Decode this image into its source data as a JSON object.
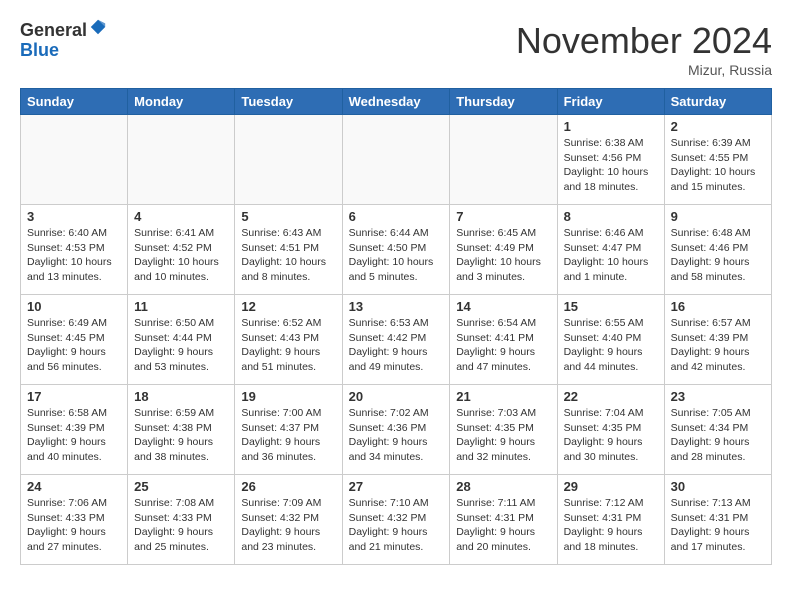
{
  "header": {
    "logo_line1": "General",
    "logo_line2": "Blue",
    "month_title": "November 2024",
    "location": "Mizur, Russia"
  },
  "weekdays": [
    "Sunday",
    "Monday",
    "Tuesday",
    "Wednesday",
    "Thursday",
    "Friday",
    "Saturday"
  ],
  "weeks": [
    [
      {
        "day": "",
        "info": ""
      },
      {
        "day": "",
        "info": ""
      },
      {
        "day": "",
        "info": ""
      },
      {
        "day": "",
        "info": ""
      },
      {
        "day": "",
        "info": ""
      },
      {
        "day": "1",
        "info": "Sunrise: 6:38 AM\nSunset: 4:56 PM\nDaylight: 10 hours\nand 18 minutes."
      },
      {
        "day": "2",
        "info": "Sunrise: 6:39 AM\nSunset: 4:55 PM\nDaylight: 10 hours\nand 15 minutes."
      }
    ],
    [
      {
        "day": "3",
        "info": "Sunrise: 6:40 AM\nSunset: 4:53 PM\nDaylight: 10 hours\nand 13 minutes."
      },
      {
        "day": "4",
        "info": "Sunrise: 6:41 AM\nSunset: 4:52 PM\nDaylight: 10 hours\nand 10 minutes."
      },
      {
        "day": "5",
        "info": "Sunrise: 6:43 AM\nSunset: 4:51 PM\nDaylight: 10 hours\nand 8 minutes."
      },
      {
        "day": "6",
        "info": "Sunrise: 6:44 AM\nSunset: 4:50 PM\nDaylight: 10 hours\nand 5 minutes."
      },
      {
        "day": "7",
        "info": "Sunrise: 6:45 AM\nSunset: 4:49 PM\nDaylight: 10 hours\nand 3 minutes."
      },
      {
        "day": "8",
        "info": "Sunrise: 6:46 AM\nSunset: 4:47 PM\nDaylight: 10 hours\nand 1 minute."
      },
      {
        "day": "9",
        "info": "Sunrise: 6:48 AM\nSunset: 4:46 PM\nDaylight: 9 hours\nand 58 minutes."
      }
    ],
    [
      {
        "day": "10",
        "info": "Sunrise: 6:49 AM\nSunset: 4:45 PM\nDaylight: 9 hours\nand 56 minutes."
      },
      {
        "day": "11",
        "info": "Sunrise: 6:50 AM\nSunset: 4:44 PM\nDaylight: 9 hours\nand 53 minutes."
      },
      {
        "day": "12",
        "info": "Sunrise: 6:52 AM\nSunset: 4:43 PM\nDaylight: 9 hours\nand 51 minutes."
      },
      {
        "day": "13",
        "info": "Sunrise: 6:53 AM\nSunset: 4:42 PM\nDaylight: 9 hours\nand 49 minutes."
      },
      {
        "day": "14",
        "info": "Sunrise: 6:54 AM\nSunset: 4:41 PM\nDaylight: 9 hours\nand 47 minutes."
      },
      {
        "day": "15",
        "info": "Sunrise: 6:55 AM\nSunset: 4:40 PM\nDaylight: 9 hours\nand 44 minutes."
      },
      {
        "day": "16",
        "info": "Sunrise: 6:57 AM\nSunset: 4:39 PM\nDaylight: 9 hours\nand 42 minutes."
      }
    ],
    [
      {
        "day": "17",
        "info": "Sunrise: 6:58 AM\nSunset: 4:39 PM\nDaylight: 9 hours\nand 40 minutes."
      },
      {
        "day": "18",
        "info": "Sunrise: 6:59 AM\nSunset: 4:38 PM\nDaylight: 9 hours\nand 38 minutes."
      },
      {
        "day": "19",
        "info": "Sunrise: 7:00 AM\nSunset: 4:37 PM\nDaylight: 9 hours\nand 36 minutes."
      },
      {
        "day": "20",
        "info": "Sunrise: 7:02 AM\nSunset: 4:36 PM\nDaylight: 9 hours\nand 34 minutes."
      },
      {
        "day": "21",
        "info": "Sunrise: 7:03 AM\nSunset: 4:35 PM\nDaylight: 9 hours\nand 32 minutes."
      },
      {
        "day": "22",
        "info": "Sunrise: 7:04 AM\nSunset: 4:35 PM\nDaylight: 9 hours\nand 30 minutes."
      },
      {
        "day": "23",
        "info": "Sunrise: 7:05 AM\nSunset: 4:34 PM\nDaylight: 9 hours\nand 28 minutes."
      }
    ],
    [
      {
        "day": "24",
        "info": "Sunrise: 7:06 AM\nSunset: 4:33 PM\nDaylight: 9 hours\nand 27 minutes."
      },
      {
        "day": "25",
        "info": "Sunrise: 7:08 AM\nSunset: 4:33 PM\nDaylight: 9 hours\nand 25 minutes."
      },
      {
        "day": "26",
        "info": "Sunrise: 7:09 AM\nSunset: 4:32 PM\nDaylight: 9 hours\nand 23 minutes."
      },
      {
        "day": "27",
        "info": "Sunrise: 7:10 AM\nSunset: 4:32 PM\nDaylight: 9 hours\nand 21 minutes."
      },
      {
        "day": "28",
        "info": "Sunrise: 7:11 AM\nSunset: 4:31 PM\nDaylight: 9 hours\nand 20 minutes."
      },
      {
        "day": "29",
        "info": "Sunrise: 7:12 AM\nSunset: 4:31 PM\nDaylight: 9 hours\nand 18 minutes."
      },
      {
        "day": "30",
        "info": "Sunrise: 7:13 AM\nSunset: 4:31 PM\nDaylight: 9 hours\nand 17 minutes."
      }
    ]
  ]
}
